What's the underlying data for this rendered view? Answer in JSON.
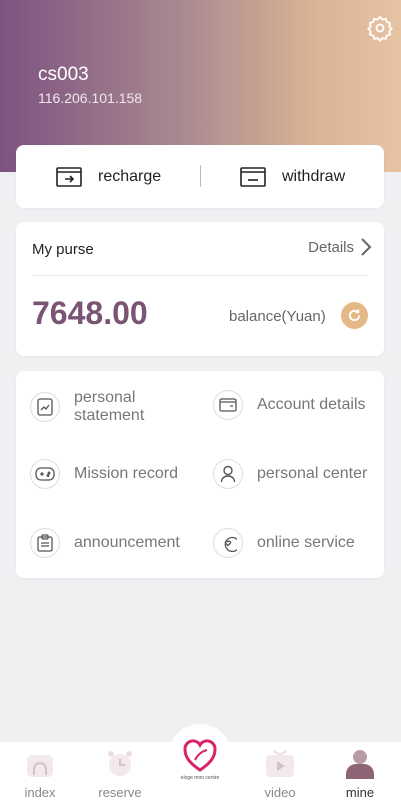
{
  "user": {
    "name": "cs003",
    "ip": "116.206.101.158"
  },
  "actions": {
    "recharge": "recharge",
    "withdraw": "withdraw"
  },
  "purse": {
    "title": "My purse",
    "details": "Details",
    "amount": "7648.00",
    "balance_label": "balance(Yuan)"
  },
  "menu": [
    {
      "label": "personal\nstatement",
      "icon": "chart-icon"
    },
    {
      "label": "Account details",
      "icon": "wallet-icon"
    },
    {
      "label": "Mission record",
      "icon": "gamepad-icon"
    },
    {
      "label": "personal center",
      "icon": "person-icon"
    },
    {
      "label": "announcement",
      "icon": "clipboard-icon"
    },
    {
      "label": "online service",
      "icon": "chat-heart-icon"
    }
  ],
  "nav": {
    "index": "index",
    "reserve": "reserve",
    "video": "video",
    "mine": "mine",
    "logo_text": "eloge mon centre"
  },
  "colors": {
    "accent": "#7a5474",
    "refresh": "#e5b888",
    "header_start": "#7d5280",
    "header_end": "#e6c3a3"
  }
}
